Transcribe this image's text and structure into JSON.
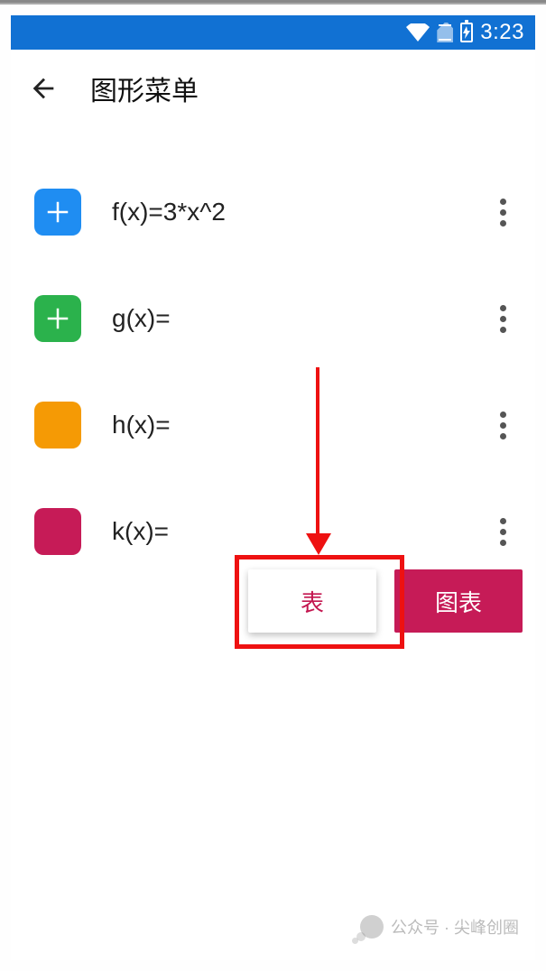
{
  "status": {
    "time": "3:23"
  },
  "header": {
    "title": "图形菜单"
  },
  "functions": [
    {
      "color": "#1f8df2",
      "showPlus": true,
      "label": "f(x)=3*x^2"
    },
    {
      "color": "#2bb24c",
      "showPlus": true,
      "label": "g(x)="
    },
    {
      "color": "#f59a05",
      "showPlus": false,
      "label": "h(x)="
    },
    {
      "color": "#c61b57",
      "showPlus": false,
      "label": "k(x)="
    }
  ],
  "buttons": {
    "table": "表",
    "chart": "图表"
  },
  "watermark": {
    "text": "公众号 · 尖峰创圈"
  }
}
